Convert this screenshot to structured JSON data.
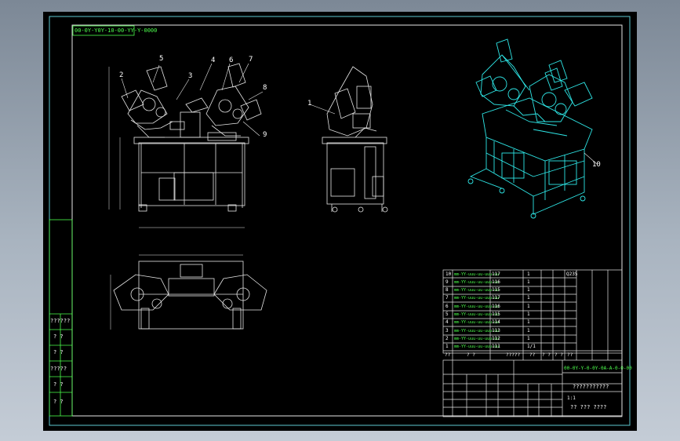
{
  "title_code": "00-0Y-Y0Y-10-00-YY-Y-0000",
  "balloons": [
    "1",
    "2",
    "3",
    "4",
    "5",
    "6",
    "7",
    "8",
    "9",
    "10"
  ],
  "parts_list": [
    {
      "no": "10",
      "name": "mm-YY-uuu-uu-uuu-uu",
      "qty": "117",
      "mat": "1",
      "note": "Q235"
    },
    {
      "no": "9",
      "name": "mm-YY-uuu-uu-uuu-uu",
      "qty": "116",
      "mat": "1",
      "note": ""
    },
    {
      "no": "8",
      "name": "mm-YY-uuu-uu-uuu-uu",
      "qty": "115",
      "mat": "1",
      "note": ""
    },
    {
      "no": "7",
      "name": "mm-YY-uuu-uu-uuu-uu",
      "qty": "117",
      "mat": "1",
      "note": ""
    },
    {
      "no": "6",
      "name": "mm-YY-uuu-uu-uuu-uu",
      "qty": "116",
      "mat": "1",
      "note": ""
    },
    {
      "no": "5",
      "name": "mm-YY-uuu-uu-uuu-uu",
      "qty": "115",
      "mat": "1",
      "note": ""
    },
    {
      "no": "4",
      "name": "mm-YY-uuu-uu-uuu-uu",
      "qty": "114",
      "mat": "1",
      "note": ""
    },
    {
      "no": "3",
      "name": "mm-YY-uuu-uu-uuu-uu",
      "qty": "113",
      "mat": "1",
      "note": ""
    },
    {
      "no": "2",
      "name": "mm-YY-uuu-uu-uuu-uu",
      "qty": "112",
      "mat": "1",
      "note": ""
    },
    {
      "no": "1",
      "name": "mm-YY-uuu-uu-uuu-uu",
      "qty": "111",
      "mat": "1/1",
      "note": ""
    }
  ],
  "parts_header": [
    "??",
    "? ?",
    "?????",
    "??",
    "? ?",
    "? ?",
    "??"
  ],
  "title_block": {
    "drawing_no": "00-0Y-Y-0-0Y-0A-A-0-0-00",
    "name": "???????????",
    "company": "?? ??? ????",
    "ratio": "1:1"
  },
  "left_stamp": [
    "??????",
    "? ?",
    "? ?",
    "?????",
    "? ?",
    "? ?"
  ]
}
